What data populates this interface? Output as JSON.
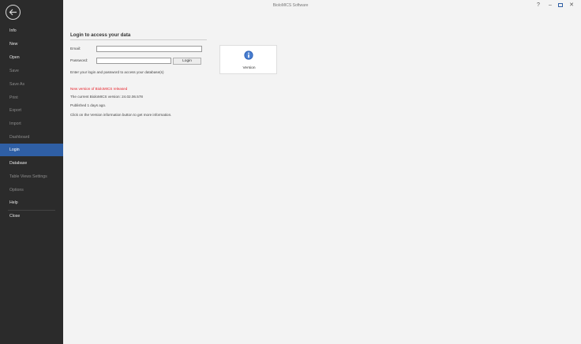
{
  "titlebar": {
    "title": "BioloMICS Software",
    "help_glyph": "?",
    "minimize_glyph": "–",
    "close_glyph": "✕"
  },
  "sidebar": {
    "items": [
      {
        "label": "Info"
      },
      {
        "label": "New"
      },
      {
        "label": "Open"
      },
      {
        "label": "Save"
      },
      {
        "label": "Save As"
      },
      {
        "label": "Print"
      },
      {
        "label": "Export"
      },
      {
        "label": "Import"
      },
      {
        "label": "Dashboard"
      },
      {
        "label": "Login"
      },
      {
        "label": "Database"
      },
      {
        "label": "Table Views Settings"
      },
      {
        "label": "Options"
      },
      {
        "label": "Help"
      },
      {
        "label": "Close"
      }
    ]
  },
  "login": {
    "heading": "Login to access your data",
    "email_label": "Email:",
    "email_value": "",
    "password_label": "Password:",
    "password_value": "",
    "login_button": "Login",
    "hint": "Enter your login and password to access your database(s)"
  },
  "update": {
    "notice": "New version of BioloMICS released",
    "current_version": "The current BioloMICS version: 24.02.06.578",
    "published": "Published 1 days ago.",
    "instruction": "Click on the Version information button to get more information."
  },
  "version_tile": {
    "label": "Version",
    "icon": "info-icon",
    "icon_color": "#2f63b8"
  },
  "colors": {
    "sidebar_bg": "#2b2b2b",
    "active_item": "#2f5fa5",
    "notice": "#e8222a"
  }
}
